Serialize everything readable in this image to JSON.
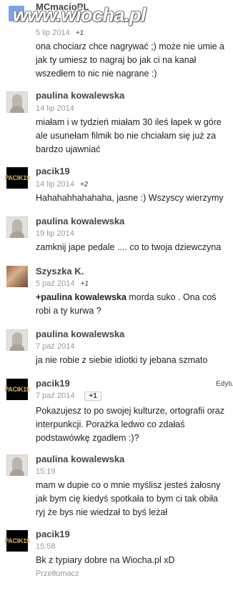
{
  "watermark": "www.wiocha.pl",
  "comments": [
    {
      "author": "MCmacioPL",
      "date": "5 lip 2014",
      "plus": "+1",
      "lines": [
        "ona chociarz chce nagrywać ;) może nie umie a",
        "jak ty umiesz to nagraj bo jak ci na kanał",
        "wszedłem to nic nie nagrane :)"
      ]
    },
    {
      "author": "paulina kowalewska",
      "date": "14 lip 2014",
      "lines": [
        "miałam i w tydzień miałam 30 ileś łapek w góre",
        "ale usunełam filmik bo nie chciałam się już za",
        "bardzo ujawniać"
      ]
    },
    {
      "author": "pacik19",
      "date": "14 lip 2014",
      "plus": "+2",
      "lines": [
        "Hahahahhahahaha, jasne :) Wszyscy wierzymy"
      ]
    },
    {
      "author": "paulina kowalewska",
      "date": "19 lip 2014",
      "lines": [
        "zamknij jape pedale .... co to twoja dziewczyna"
      ]
    },
    {
      "author": "Szyszka K.",
      "date": "5 paź 2014",
      "plus": "+1",
      "mention": "+paulina kowalewska",
      "lines": [
        " morda suko . Ona coś",
        "robi a ty kurwa ?"
      ]
    },
    {
      "author": "paulina kowalewska",
      "date": "7 paź 2014",
      "lines": [
        "ja nie robie z siebie idiotki ty jebana szmato"
      ]
    },
    {
      "author": "pacik19",
      "date": "7 paź 2014",
      "plus": "+1",
      "edit": "Edytu",
      "lines": [
        "Pokazujesz to po swojej kulturze, ortografii oraz",
        "interpunkcji. Porażka ledwo co zdałaś",
        "podstawówkę zgadłem :)?"
      ]
    },
    {
      "author": "paulina kowalewska",
      "date": "15:19",
      "lines": [
        "mam w dupie co o mnie myślisz jesteś żałosny",
        "jak bym cię kiedyś spotkała to bym ci tak obiła",
        "ryj że bys nie wiedzał to byś leżał"
      ]
    },
    {
      "author": "pacik19",
      "date": "15:58",
      "lines": [
        "Bk z typiary dobre na Wiocha.pl xD"
      ],
      "translate": "Przetłumacz"
    }
  ],
  "avatar_label": "PACIK19"
}
